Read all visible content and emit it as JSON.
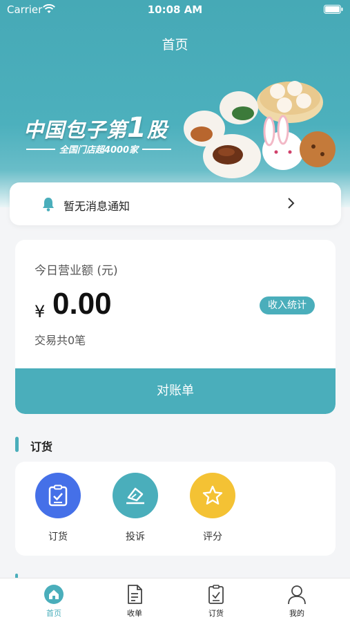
{
  "status_bar": {
    "carrier": "Carrier",
    "time": "10:08 AM"
  },
  "nav": {
    "title": "首页"
  },
  "banner": {
    "headline": "中国包子第",
    "headline_number": "1",
    "headline_suffix": "股",
    "subline": "全国门店超4000家"
  },
  "notice": {
    "text": "暂无消息通知"
  },
  "revenue": {
    "label": "今日营业额 (元)",
    "currency": "¥",
    "amount": "0.00",
    "stats_button": "收入统计",
    "transactions": "交易共0笔",
    "statement_button": "对账单"
  },
  "ordering": {
    "section_title": "订货",
    "items": [
      {
        "label": "订货",
        "icon": "clipboard-check-icon",
        "color": "#4570e8"
      },
      {
        "label": "投诉",
        "icon": "complaint-icon",
        "color": "#4aaebb"
      },
      {
        "label": "评分",
        "icon": "star-icon",
        "color": "#f4c234"
      }
    ]
  },
  "tabbar": {
    "items": [
      {
        "label": "首页",
        "icon": "home-icon",
        "active": true
      },
      {
        "label": "收单",
        "icon": "document-icon",
        "active": false
      },
      {
        "label": "订货",
        "icon": "clipboard-check-icon",
        "active": false
      },
      {
        "label": "我的",
        "icon": "user-icon",
        "active": false
      }
    ],
    "active_color": "#4aaebb"
  },
  "colors": {
    "accent": "#4aaebb",
    "header": "#4cb0bd"
  }
}
